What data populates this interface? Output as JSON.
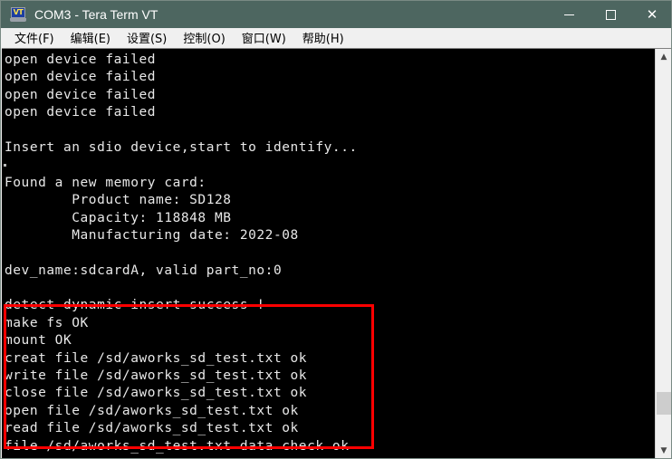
{
  "window": {
    "title": "COM3 - Tera Term VT",
    "icon": "terminal-vt-icon",
    "controls": {
      "minimize": "─",
      "maximize": "□",
      "close": "✕"
    }
  },
  "menubar": {
    "items": [
      {
        "label": "文件(F)",
        "name": "menu-file"
      },
      {
        "label": "编辑(E)",
        "name": "menu-edit"
      },
      {
        "label": "设置(S)",
        "name": "menu-setup"
      },
      {
        "label": "控制(O)",
        "name": "menu-control"
      },
      {
        "label": "窗口(W)",
        "name": "menu-window"
      },
      {
        "label": "帮助(H)",
        "name": "menu-help"
      }
    ]
  },
  "terminal": {
    "background": "#000000",
    "foreground": "#e8e8e8",
    "lines": [
      "open device failed",
      "open device failed",
      "open device failed",
      "open device failed",
      "",
      "Insert an sdio device,start to identify...",
      "",
      "Found a new memory card:",
      "        Product name: SD128",
      "        Capacity: 118848 MB",
      "        Manufacturing date: 2022-08",
      "",
      "dev_name:sdcardA, valid part_no:0",
      "",
      "detect dynamic insert success !",
      "make fs OK",
      "mount OK",
      "creat file /sd/aworks_sd_test.txt ok",
      "write file /sd/aworks_sd_test.txt ok",
      "close file /sd/aworks_sd_test.txt ok",
      "open file /sd/aworks_sd_test.txt ok",
      "read file /sd/aworks_sd_test.txt ok",
      "file /sd/aworks_sd_test.txt data check ok"
    ]
  },
  "highlight": {
    "color": "#fe0000",
    "label": "red-annotation-box"
  },
  "scrollbar": {
    "up_arrow": "▲",
    "down_arrow": "▼"
  }
}
